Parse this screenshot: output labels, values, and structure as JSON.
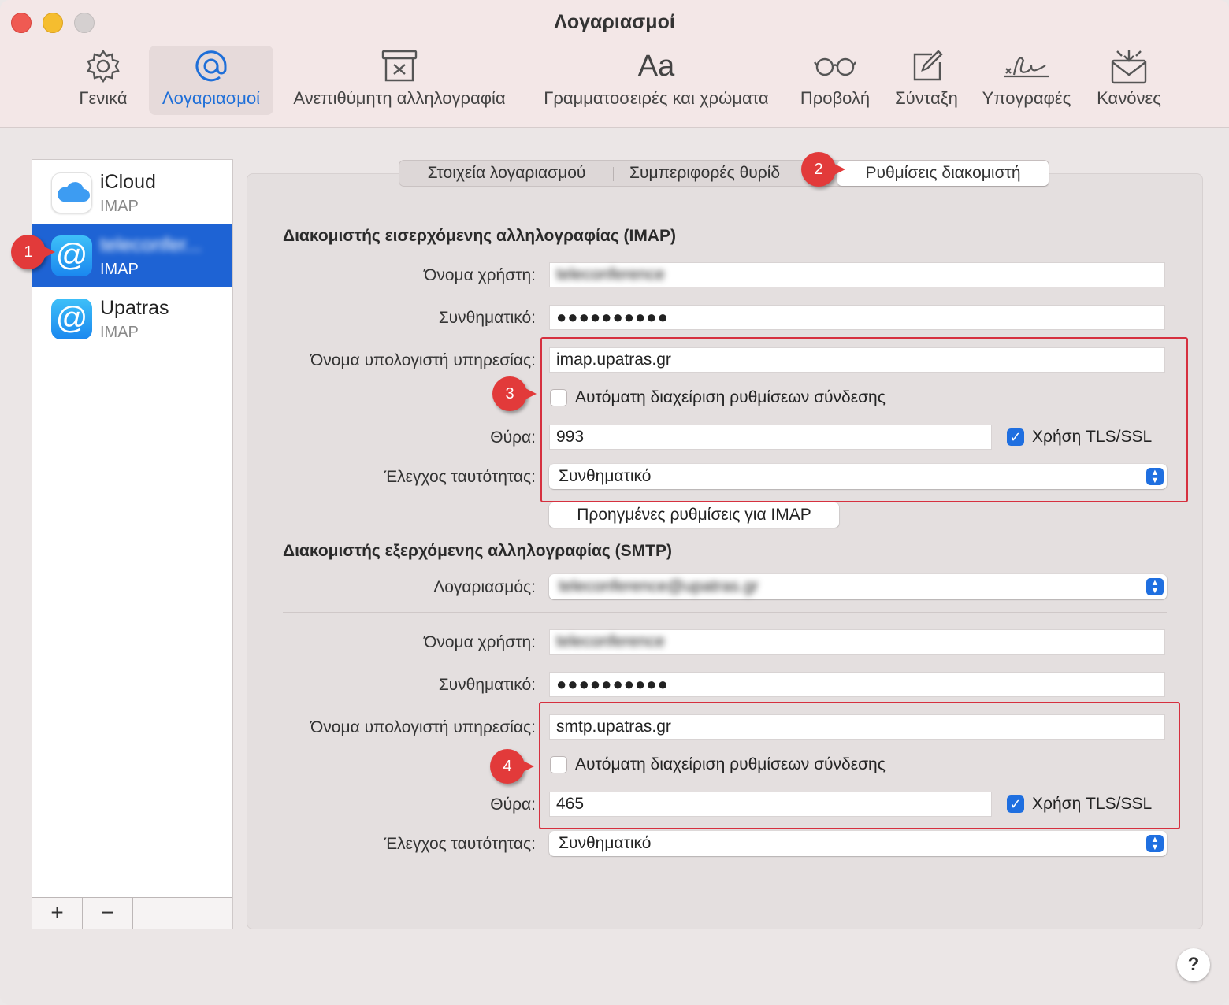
{
  "window": {
    "title": "Λογαριασμοί"
  },
  "toolbar": {
    "items": [
      {
        "label": "Γενικά",
        "icon": "gear-icon"
      },
      {
        "label": "Λογαριασμοί",
        "icon": "at-icon"
      },
      {
        "label": "Ανεπιθύμητη αλληλογραφία",
        "icon": "junk-icon"
      },
      {
        "label": "Γραμματοσειρές και χρώματα",
        "icon": "font-icon",
        "glyph": "Aa"
      },
      {
        "label": "Προβολή",
        "icon": "glasses-icon"
      },
      {
        "label": "Σύνταξη",
        "icon": "compose-icon"
      },
      {
        "label": "Υπογραφές",
        "icon": "signature-icon"
      },
      {
        "label": "Κανόνες",
        "icon": "rules-icon"
      }
    ]
  },
  "sidebar": {
    "accounts": [
      {
        "name": "iCloud",
        "type": "IMAP"
      },
      {
        "name": "teleconfer...",
        "type": "IMAP"
      },
      {
        "name": "Upatras",
        "type": "IMAP"
      }
    ],
    "add_label": "+",
    "remove_label": "−"
  },
  "tabs": {
    "items": [
      "Στοιχεία λογαριασμού",
      "Συμπεριφορές θυρίδ",
      "Ρυθμίσεις διακομιστή"
    ]
  },
  "imap": {
    "section_title": "Διακομιστής εισερχόμενης αλληλογραφίας (IMAP)",
    "username_label": "Όνομα χρήστη:",
    "username_value": "teleconference",
    "password_label": "Συνθηματικό:",
    "password_value": "●●●●●●●●●●",
    "host_label": "Όνομα υπολογιστή υπηρεσίας:",
    "host_value": "imap.upatras.gr",
    "auto_label": "Αυτόματη διαχείριση ρυθμίσεων σύνδεσης",
    "port_label": "Θύρα:",
    "port_value": "993",
    "tls_label": "Χρήση TLS/SSL",
    "auth_label": "Έλεγχος ταυτότητας:",
    "auth_value": "Συνθηματικό",
    "advanced_button": "Προηγμένες ρυθμίσεις για IMAP"
  },
  "smtp": {
    "section_title": "Διακομιστής εξερχόμενης αλληλογραφίας (SMTP)",
    "account_label": "Λογαριασμός:",
    "account_value": "teleconference@upatras.gr",
    "username_label": "Όνομα χρήστη:",
    "username_value": "teleconference",
    "password_label": "Συνθηματικό:",
    "password_value": "●●●●●●●●●●",
    "host_label": "Όνομα υπολογιστή υπηρεσίας:",
    "host_value": "smtp.upatras.gr",
    "auto_label": "Αυτόματη διαχείριση ρυθμίσεων σύνδεσης",
    "port_label": "Θύρα:",
    "port_value": "465",
    "tls_label": "Χρήση TLS/SSL",
    "auth_label": "Έλεγχος ταυτότητας:",
    "auth_value": "Συνθηματικό"
  },
  "annotations": [
    "1",
    "2",
    "3",
    "4"
  ],
  "help_label": "?",
  "colors": {
    "accent": "#1f6fe0",
    "selection": "#1e63d4",
    "annotation": "#e23a3a"
  }
}
